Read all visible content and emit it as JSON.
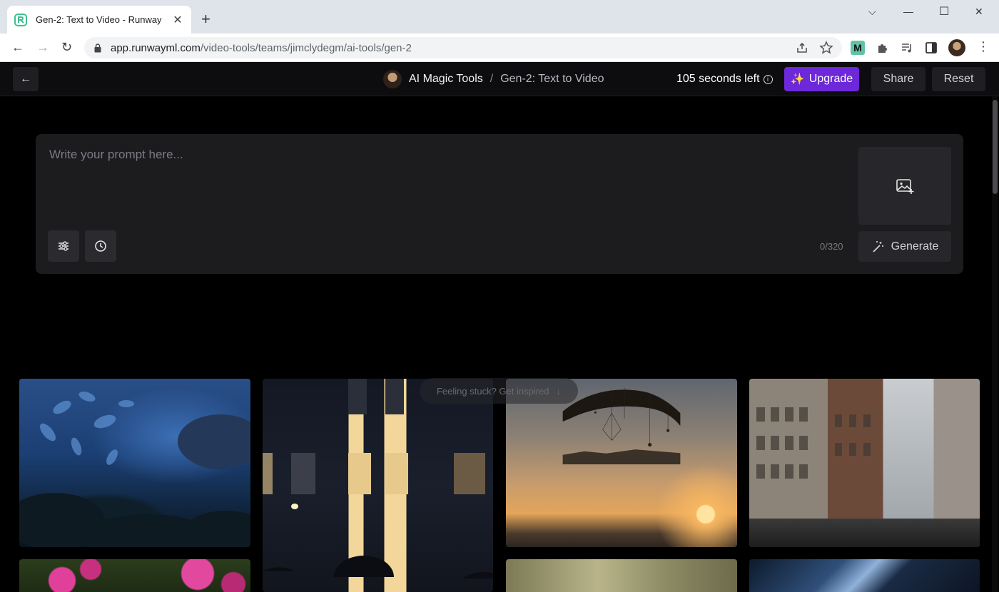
{
  "browser": {
    "tab_title": "Gen-2: Text to Video - Runway",
    "tab_close": "✕",
    "new_tab": "+",
    "url_host": "app.runwayml.com",
    "url_path": "/video-tools/teams/jimclydegm/ai-tools/gen-2",
    "window_controls": {
      "dropdown": "⌵",
      "minimize": "—",
      "maximize": "☐",
      "close": "✕"
    },
    "nav": {
      "back": "←",
      "forward": "→",
      "reload": "↻"
    },
    "extension_m": "M",
    "menu": "⋮"
  },
  "header": {
    "back": "←",
    "breadcrumb": [
      "AI Magic Tools",
      "Gen-2: Text to Video"
    ],
    "breadcrumb_sep": "/",
    "seconds_left": "105 seconds left",
    "info": "i",
    "upgrade_icon": "✨",
    "upgrade_label": "Upgrade",
    "share_label": "Share",
    "reset_label": "Reset"
  },
  "prompt": {
    "placeholder": "Write your prompt here...",
    "value": "",
    "counter": "0/320",
    "generate_label": "Generate"
  },
  "inspire": {
    "label": "Feeling stuck? Get inspired",
    "arrow": "↓"
  },
  "colors": {
    "accent": "#6d28d9",
    "panel": "#1c1c1f",
    "background": "#000000"
  }
}
